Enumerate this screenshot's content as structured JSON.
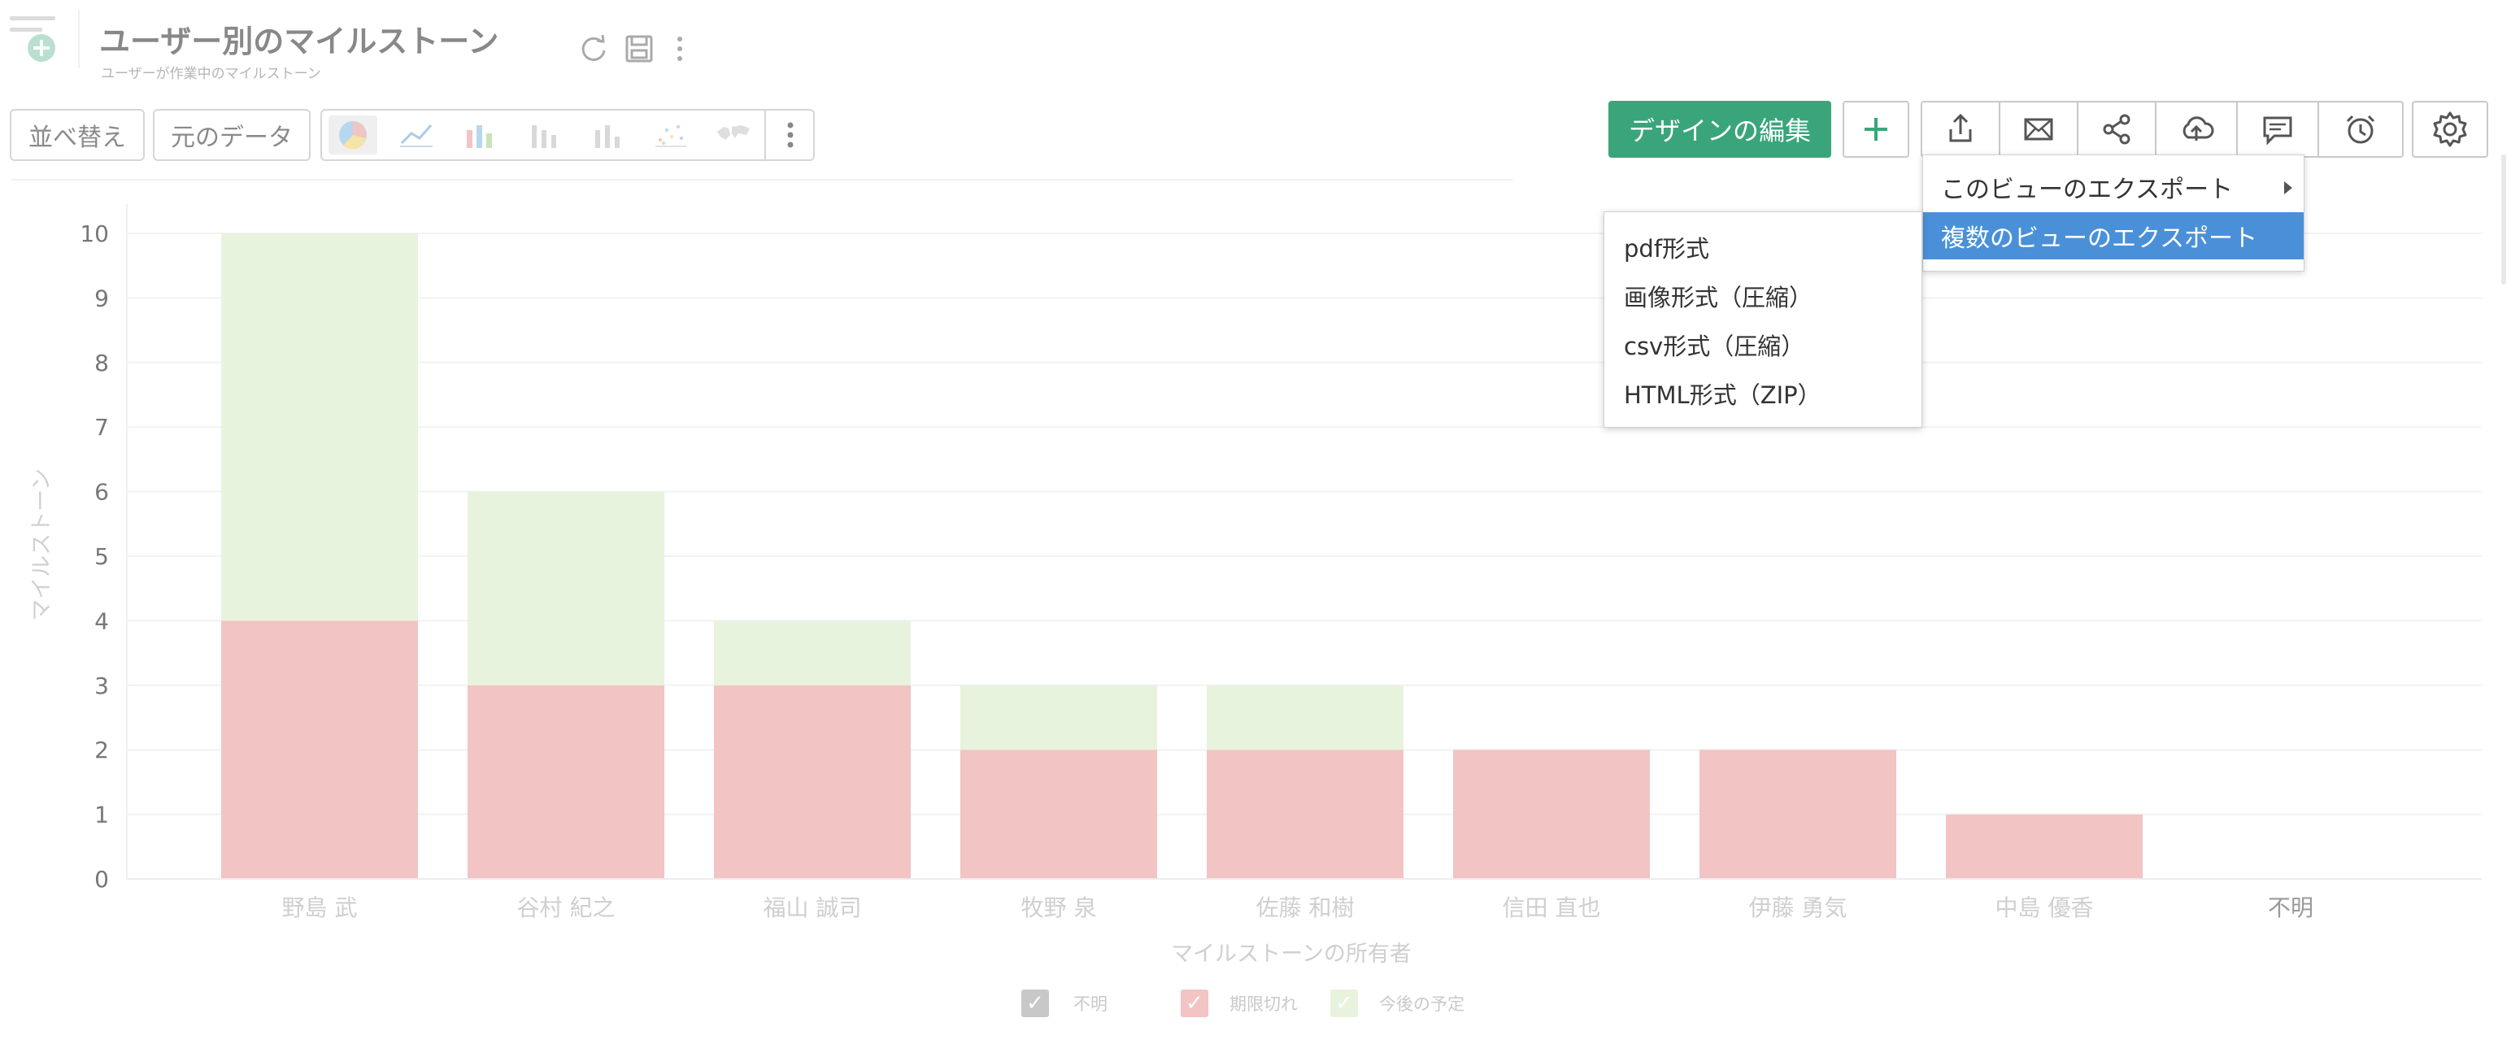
{
  "header": {
    "title": "ユーザー別のマイルストーン",
    "subtitle": "ユーザーが作業中のマイルストーン",
    "icons": [
      "refresh-icon",
      "save-icon",
      "more-vertical-icon"
    ]
  },
  "toolbar": {
    "sort_label": "並べ替え",
    "raw_data_label": "元のデータ",
    "chart_types": [
      "pie-chart-icon",
      "line-chart-icon",
      "bar-chart-icon",
      "stacked-bar-chart-icon",
      "column-chart-icon",
      "scatter-chart-icon",
      "map-chart-icon",
      "more-vertical-icon"
    ],
    "edit_design_label": "デザインの編集",
    "add_icon": "plus-icon",
    "action_icons": [
      "export-icon",
      "mail-icon",
      "share-icon",
      "cloud-upload-icon",
      "comment-icon",
      "alarm-icon"
    ],
    "settings_icon": "gear-icon"
  },
  "export_menu": {
    "items": [
      "このビューのエクスポート",
      "複数のビューのエクスポート"
    ],
    "selected_index": 1,
    "sub_items": [
      "pdf形式",
      "画像形式（圧縮）",
      "csv形式（圧縮）",
      "HTML形式（ZIP）"
    ]
  },
  "colors": {
    "accent_green": "#3aa57a",
    "selected_blue": "#4a90d9",
    "overdue": "#f2c4c4",
    "upcoming": "#e8f3de",
    "unknown": "#c8c8c8"
  },
  "chart_data": {
    "type": "bar",
    "stacked": true,
    "categories": [
      "野島 武",
      "谷村 紀之",
      "福山 誠司",
      "牧野 泉",
      "佐藤 和樹",
      "信田 直也",
      "伊藤 勇気",
      "中島 優香",
      "不明"
    ],
    "series": [
      {
        "name": "不明",
        "values": [
          0,
          0,
          0,
          0,
          0,
          0,
          0,
          0,
          0
        ],
        "color": "#c8c8c8"
      },
      {
        "name": "期限切れ",
        "values": [
          4,
          3,
          3,
          2,
          2,
          2,
          2,
          1,
          0
        ],
        "color": "#f2c4c4"
      },
      {
        "name": "今後の予定",
        "values": [
          6,
          3,
          1,
          1,
          1,
          0,
          0,
          0,
          0
        ],
        "color": "#e8f3de"
      }
    ],
    "xlabel": "マイルストーンの所有者",
    "ylabel": "マイルストーン",
    "ylim": [
      0,
      10
    ],
    "yticks": [
      "0",
      "1",
      "2",
      "3",
      "4",
      "5",
      "6",
      "7",
      "8",
      "9",
      "10"
    ],
    "grid": true,
    "legend_position": "bottom-center"
  }
}
